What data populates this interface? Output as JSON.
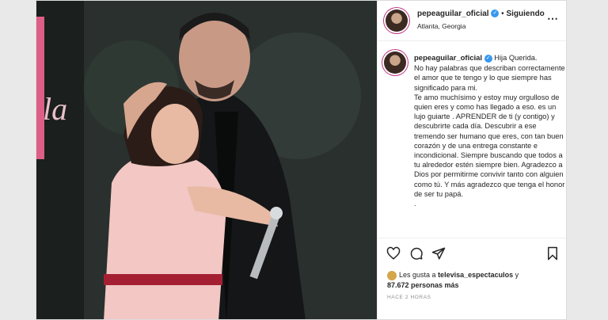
{
  "header": {
    "username": "pepeaguilar_oficial",
    "separator": "•",
    "follow_status": "Siguiendo",
    "location": "Atlanta, Georgia",
    "more_icon": "ellipsis-icon"
  },
  "caption": {
    "username": "pepeaguilar_oficial",
    "text": "Hija Querida.\nNo hay palabras que describan correctamente el amor que te tengo y lo que siempre has significado para mi.\nTe amo muchísimo y estoy muy orgulloso de quien eres y como has llegado a eso. es un lujo guiarte . APRENDER de ti (y contigo) y descubrirte cada día. Descubrir a ese tremendo ser humano que eres, con tan buen corazón y de una entrega constante e incondicional. Siempre buscando que todos a tu alrededor estén siempre bien. Agradezco a Dios por permitirme convivir tanto con alguien como tú. Y más agradezco que tenga el honor de ser tu papá.\n."
  },
  "actions": {
    "icons": [
      "heart-icon",
      "comment-icon",
      "share-icon",
      "bookmark-icon"
    ]
  },
  "likes": {
    "prefix": "Les gusta a",
    "user": "televisa_espectaculos",
    "connector": "y",
    "count": "87.672 personas más"
  },
  "time": "HACE 2 HORAS",
  "colors": {
    "verified": "#3897f0",
    "neon": "#ff6a9a",
    "dress": "#f2c7c4"
  }
}
